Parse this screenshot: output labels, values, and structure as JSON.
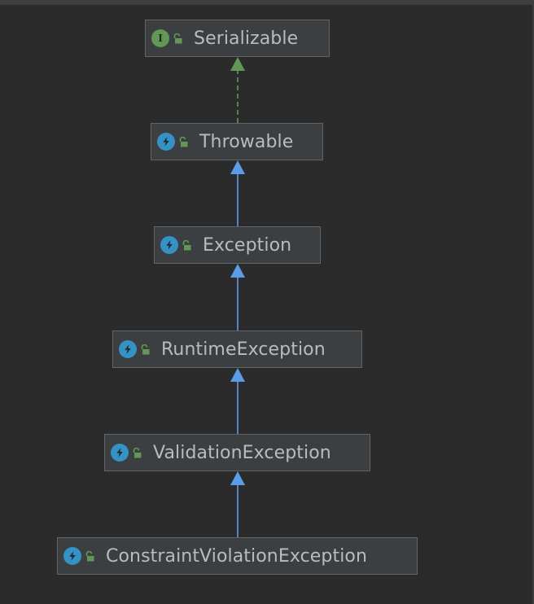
{
  "diagram": {
    "nodes": [
      {
        "id": "serializable",
        "label": "Serializable",
        "kind": "interface",
        "icon": "interface-icon",
        "visibility": "public"
      },
      {
        "id": "throwable",
        "label": "Throwable",
        "kind": "class",
        "icon": "exception-class-icon",
        "visibility": "public"
      },
      {
        "id": "exception",
        "label": "Exception",
        "kind": "class",
        "icon": "exception-class-icon",
        "visibility": "public"
      },
      {
        "id": "runtime-exception",
        "label": "RuntimeException",
        "kind": "class",
        "icon": "exception-class-icon",
        "visibility": "public"
      },
      {
        "id": "validation-exception",
        "label": "ValidationException",
        "kind": "class",
        "icon": "exception-class-icon",
        "visibility": "public"
      },
      {
        "id": "constraint-violation-exception",
        "label": "ConstraintViolationException",
        "kind": "class",
        "icon": "exception-class-icon",
        "visibility": "public"
      }
    ],
    "edges": [
      {
        "from": "throwable",
        "to": "serializable",
        "type": "implements",
        "style": "dashed",
        "color": "#629755"
      },
      {
        "from": "exception",
        "to": "throwable",
        "type": "extends",
        "style": "solid",
        "color": "#5c9be8"
      },
      {
        "from": "runtime-exception",
        "to": "exception",
        "type": "extends",
        "style": "solid",
        "color": "#5c9be8"
      },
      {
        "from": "validation-exception",
        "to": "runtime-exception",
        "type": "extends",
        "style": "solid",
        "color": "#5c9be8"
      },
      {
        "from": "constraint-violation-exception",
        "to": "validation-exception",
        "type": "extends",
        "style": "solid",
        "color": "#5c9be8"
      }
    ],
    "colors": {
      "background": "#2b2b2b",
      "node_fill": "#3c3f41",
      "node_border": "#646464",
      "label_text": "#bbbbbb",
      "class_icon": "#3592c4",
      "interface_icon": "#629755",
      "public_lock": "#629755",
      "extends_arrow": "#5c9be8",
      "implements_arrow": "#629755"
    },
    "interface_icon_letter": "I"
  }
}
